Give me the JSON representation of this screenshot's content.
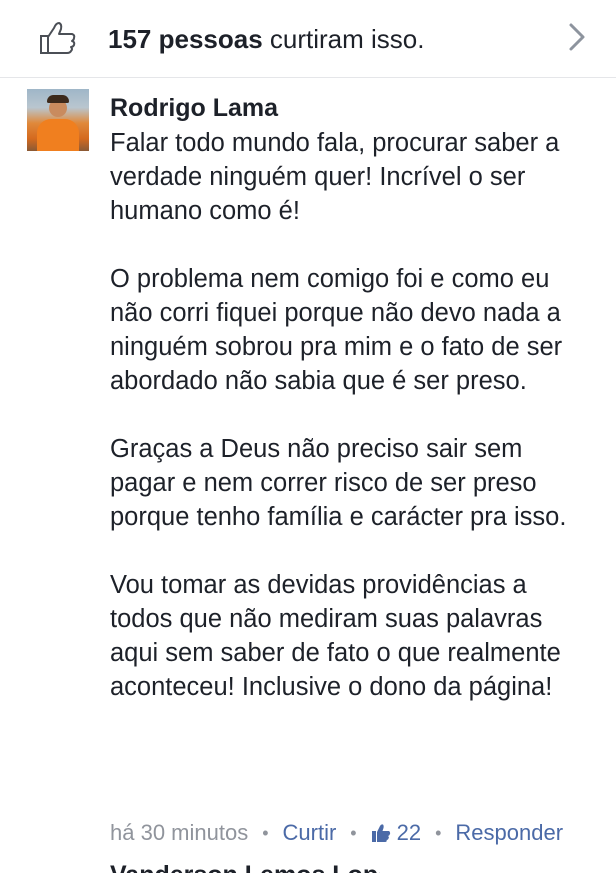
{
  "likes_bar": {
    "count_text": "157 pessoas",
    "rest_text": " curtiram isso.",
    "like_icon": "thumbs-up-outline-icon",
    "chevron_icon": "chevron-right-icon"
  },
  "comment": {
    "author": "Rodrigo Lama",
    "avatar_icon": "user-avatar-photo",
    "paragraphs": [
      "Falar todo mundo fala, procurar saber a verdade ninguém quer! Incrível o ser humano como é!",
      "O problema nem comigo foi e como eu não corri fiquei porque não devo nada a ninguém sobrou pra mim e o fato de ser abordado não sabia que é ser preso.",
      "Graças a Deus não preciso sair sem pagar e nem correr risco de ser preso porque tenho família e carácter pra isso.",
      "Vou tomar as devidas providências a todos que não mediram suas palavras aqui sem saber de fato o que realmente aconteceu! Inclusive o dono da página!"
    ],
    "meta": {
      "time": "há 30 minutos",
      "separator": "•",
      "like_action": "Curtir",
      "like_count_icon": "thumbs-up-filled-icon",
      "like_count": "22",
      "reply_action": "Responder"
    }
  },
  "next_comment": {
    "author_partial": "Vanderson Lemos Lopes"
  },
  "colors": {
    "link": "#4b6aa7",
    "meta_gray": "#90949c",
    "text": "#1d2129"
  }
}
